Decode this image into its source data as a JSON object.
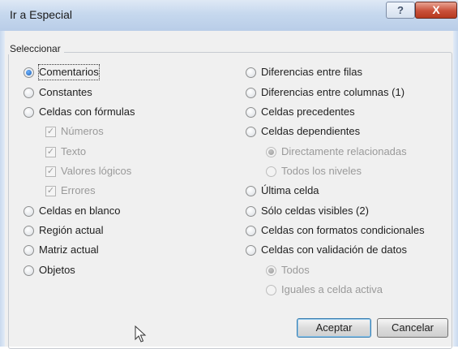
{
  "window": {
    "title": "Ir a Especial"
  },
  "titlebar_buttons": {
    "help": "?",
    "close": "X"
  },
  "group": {
    "label": "Seleccionar"
  },
  "left_options": [
    {
      "label": "Comentarios",
      "type": "radio",
      "selected": true,
      "enabled": true
    },
    {
      "label": "Constantes",
      "type": "radio",
      "selected": false,
      "enabled": true
    },
    {
      "label": "Celdas con fórmulas",
      "type": "radio",
      "selected": false,
      "enabled": true
    },
    {
      "label": "Números",
      "type": "checkbox",
      "checked": true,
      "enabled": false
    },
    {
      "label": "Texto",
      "type": "checkbox",
      "checked": true,
      "enabled": false
    },
    {
      "label": "Valores lógicos",
      "type": "checkbox",
      "checked": true,
      "enabled": false
    },
    {
      "label": "Errores",
      "type": "checkbox",
      "checked": true,
      "enabled": false
    },
    {
      "label": "Celdas en blanco",
      "type": "radio",
      "selected": false,
      "enabled": true
    },
    {
      "label": "Región actual",
      "type": "radio",
      "selected": false,
      "enabled": true
    },
    {
      "label": "Matriz actual",
      "type": "radio",
      "selected": false,
      "enabled": true
    },
    {
      "label": "Objetos",
      "type": "radio",
      "selected": false,
      "enabled": true
    }
  ],
  "right_options": [
    {
      "label": "Diferencias entre filas",
      "type": "radio",
      "selected": false,
      "enabled": true
    },
    {
      "label": "Diferencias entre columnas (1)",
      "type": "radio",
      "selected": false,
      "enabled": true
    },
    {
      "label": "Celdas precedentes",
      "type": "radio",
      "selected": false,
      "enabled": true
    },
    {
      "label": "Celdas dependientes",
      "type": "radio",
      "selected": false,
      "enabled": true
    },
    {
      "label": "Directamente relacionadas",
      "type": "radio",
      "selected": true,
      "enabled": false
    },
    {
      "label": "Todos los niveles",
      "type": "radio",
      "selected": false,
      "enabled": false
    },
    {
      "label": "Última celda",
      "type": "radio",
      "selected": false,
      "enabled": true
    },
    {
      "label": "Sólo celdas visibles (2)",
      "type": "radio",
      "selected": false,
      "enabled": true
    },
    {
      "label": "Celdas con formatos condicionales",
      "type": "radio",
      "selected": false,
      "enabled": true
    },
    {
      "label": "Celdas con validación de datos",
      "type": "radio",
      "selected": false,
      "enabled": true
    },
    {
      "label": "Todos",
      "type": "radio",
      "selected": true,
      "enabled": false
    },
    {
      "label": "Iguales a celda activa",
      "type": "radio",
      "selected": false,
      "enabled": false
    }
  ],
  "buttons": {
    "ok": "Aceptar",
    "cancel": "Cancelar"
  },
  "icons": {
    "cursor": "mouse-pointer-icon",
    "help": "help-icon",
    "close": "close-icon"
  }
}
